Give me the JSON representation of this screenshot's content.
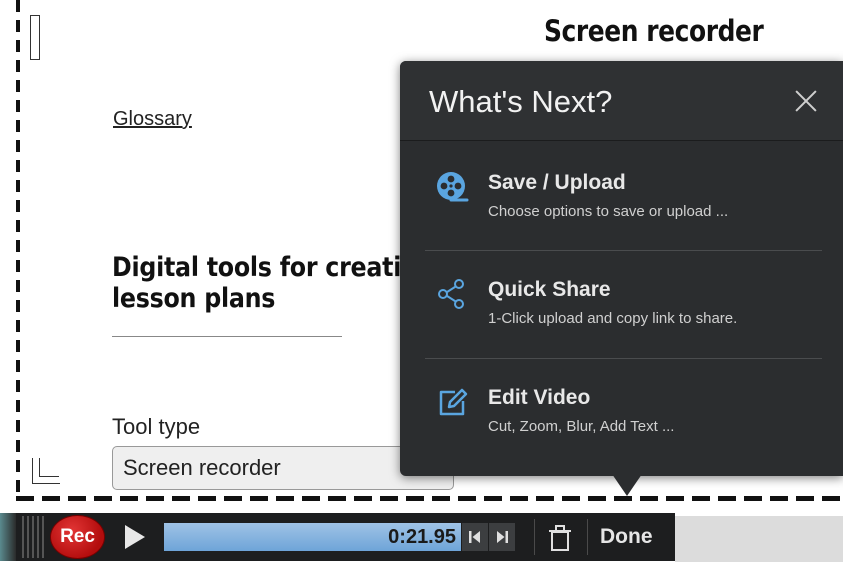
{
  "page": {
    "heading_right": "Screen recorder",
    "glossary_link": "Glossary",
    "section_heading": "Digital tools for creati\nlesson plans",
    "tool_type_label": "Tool type",
    "tool_type_value": "Screen recorder"
  },
  "popup": {
    "title": "What's Next?",
    "options": [
      {
        "icon": "film-reel-icon",
        "title": "Save / Upload",
        "desc": "Choose options to save or upload ..."
      },
      {
        "icon": "share-icon",
        "title": "Quick Share",
        "desc": "1-Click upload and copy link to share."
      },
      {
        "icon": "edit-icon",
        "title": "Edit Video",
        "desc": "Cut, Zoom, Blur, Add Text ..."
      }
    ],
    "accent_color": "#5aa5e0"
  },
  "toolbar": {
    "rec_label": "Rec",
    "time": "0:21.95",
    "done_label": "Done"
  }
}
